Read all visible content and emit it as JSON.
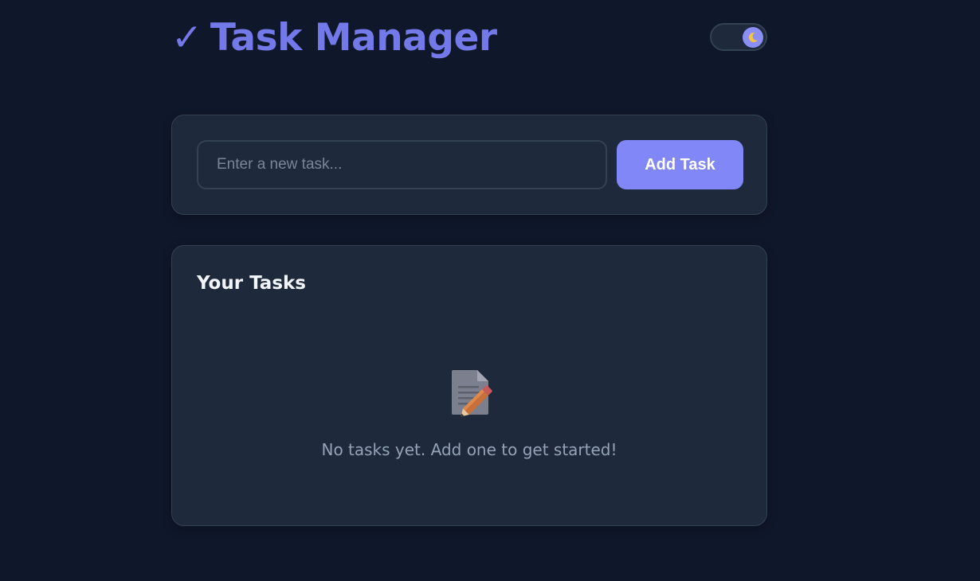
{
  "header": {
    "title_check": "✓",
    "title": "Task Manager",
    "theme_toggle_icon": "moon-icon"
  },
  "new_task": {
    "placeholder": "Enter a new task...",
    "value": "",
    "add_label": "Add Task"
  },
  "tasks": {
    "heading": "Your Tasks",
    "items": [],
    "empty_icon": "memo-icon",
    "empty_message": "No tasks yet. Add one to get started!"
  },
  "colors": {
    "background": "#0f172a",
    "card": "#1e293b",
    "accent": "#8287f7",
    "title": "#7479e9",
    "muted_text": "#94a3b8"
  }
}
